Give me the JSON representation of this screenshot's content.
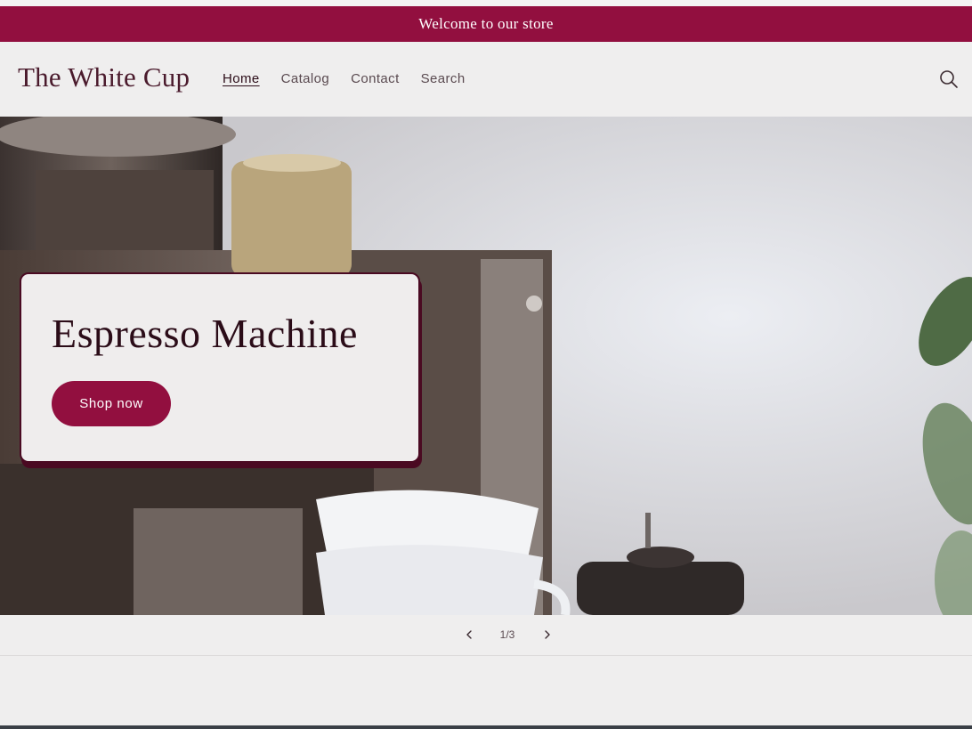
{
  "announcement": {
    "text": "Welcome to our store"
  },
  "header": {
    "logo": "The White Cup",
    "nav": {
      "home": "Home",
      "catalog": "Catalog",
      "contact": "Contact",
      "search": "Search"
    },
    "search_icon": "search-icon"
  },
  "hero": {
    "title": "Espresso Machine",
    "button_label": "Shop now"
  },
  "slider": {
    "counter": "1/3",
    "prev_icon": "chevron-left-icon",
    "next_icon": "chevron-right-icon"
  },
  "colors": {
    "brand": "#920f3f",
    "text_dark": "#2b0c18",
    "background": "#efeeee"
  }
}
